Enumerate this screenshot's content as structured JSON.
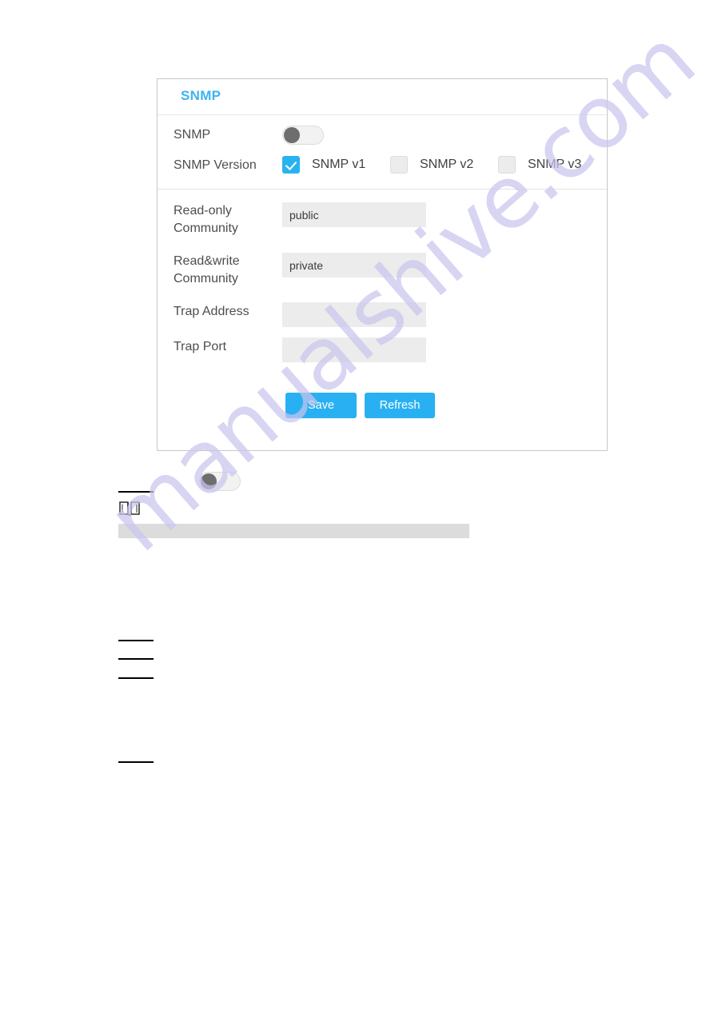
{
  "panel": {
    "title": "SNMP",
    "rows": {
      "snmp_enable_label": "SNMP",
      "snmp_version_label": "SNMP Version",
      "read_only_label": "Read-only Community",
      "read_write_label": "Read&write Community",
      "trap_address_label": "Trap Address",
      "trap_port_label": "Trap Port"
    },
    "toggle": {
      "name": "snmp-enable-toggle",
      "state": "off"
    },
    "versions": [
      {
        "label": "SNMP v1",
        "checked": true
      },
      {
        "label": "SNMP v2",
        "checked": false
      },
      {
        "label": "SNMP v3",
        "checked": false
      }
    ],
    "fields": {
      "read_only_community": {
        "value": "public",
        "placeholder": ""
      },
      "read_write_community": {
        "value": "private",
        "placeholder": ""
      },
      "trap_address": {
        "value": "",
        "placeholder": ""
      },
      "trap_port": {
        "value": "",
        "placeholder": ""
      }
    },
    "buttons": {
      "save": "Save",
      "refresh": "Refresh"
    }
  },
  "below": {
    "standalone_toggle_state": "off",
    "note_icon": "open-book-icon"
  },
  "watermark": {
    "text": "manualshive.com"
  },
  "colors": {
    "accent_blue": "#29b0f2",
    "title_blue": "#3cb4ef",
    "input_bg": "#ececec",
    "panel_border": "#c8c8c8",
    "toggle_knob": "#6e6e6e",
    "gray_bar": "#dcdcdc",
    "watermark": "#c9c6ee"
  }
}
